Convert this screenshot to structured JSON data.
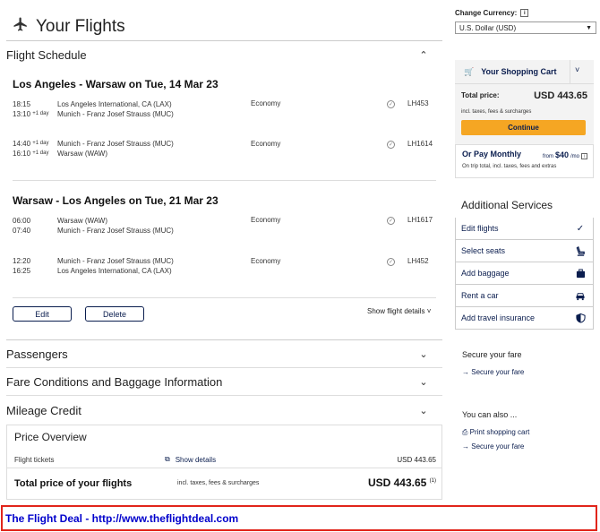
{
  "header": {
    "title": "Your Flights"
  },
  "schedule": {
    "title": "Flight Schedule",
    "trips": [
      {
        "title": "Los Angeles - Warsaw on Tue, 14 Mar 23",
        "segments": [
          {
            "dep_time": "18:15",
            "arr_time": "13:10",
            "dep_sup": "",
            "arr_sup": "+1 day",
            "from": "Los Angeles International, CA (LAX)",
            "to": "Munich - Franz Josef Strauss (MUC)",
            "cabin": "Economy",
            "flight": "LH453"
          },
          {
            "dep_time": "14:40",
            "arr_time": "16:10",
            "dep_sup": "+1 day",
            "arr_sup": "+1 day",
            "from": "Munich - Franz Josef Strauss (MUC)",
            "to": "Warsaw (WAW)",
            "cabin": "Economy",
            "flight": "LH1614"
          }
        ]
      },
      {
        "title": "Warsaw - Los Angeles on Tue, 21 Mar 23",
        "segments": [
          {
            "dep_time": "06:00",
            "arr_time": "07:40",
            "dep_sup": "",
            "arr_sup": "",
            "from": "Warsaw (WAW)",
            "to": "Munich - Franz Josef Strauss (MUC)",
            "cabin": "Economy",
            "flight": "LH1617"
          },
          {
            "dep_time": "12:20",
            "arr_time": "16:25",
            "dep_sup": "",
            "arr_sup": "",
            "from": "Munich - Franz Josef Strauss (MUC)",
            "to": "Los Angeles International, CA (LAX)",
            "cabin": "Economy",
            "flight": "LH452"
          }
        ]
      }
    ],
    "edit_label": "Edit",
    "delete_label": "Delete",
    "show_details_label": "Show flight details"
  },
  "sections": {
    "passengers": "Passengers",
    "fare_conditions": "Fare Conditions and Baggage Information",
    "mileage": "Mileage Credit"
  },
  "price_overview": {
    "title": "Price Overview",
    "tickets_label": "Flight tickets",
    "show_details": "Show details",
    "tickets_amount": "USD 443.65",
    "total_label": "Total price of your flights",
    "total_note": "incl. taxes, fees & surcharges",
    "total_amount": "USD 443.65",
    "total_footnote": "(1)"
  },
  "currency": {
    "label": "Change Currency:",
    "info": "i",
    "selected": "U.S. Dollar (USD)"
  },
  "cart": {
    "title": "Your Shopping Cart",
    "total_label": "Total price:",
    "total_amount": "USD 443.65",
    "note": "incl. taxes, fees & surcharges",
    "continue_label": "Continue",
    "monthly_label": "Or Pay Monthly",
    "monthly_from": "from",
    "monthly_amount": "$40",
    "monthly_unit": "/mo",
    "monthly_note": "On trip total, incl. taxes, fees and extras"
  },
  "additional_services": {
    "title": "Additional Services",
    "items": [
      {
        "label": "Edit flights",
        "icon": "checkmark-icon"
      },
      {
        "label": "Select seats",
        "icon": "seat-icon"
      },
      {
        "label": "Add baggage",
        "icon": "baggage-icon"
      },
      {
        "label": "Rent a car",
        "icon": "car-icon"
      },
      {
        "label": "Add travel insurance",
        "icon": "shield-icon"
      }
    ]
  },
  "secure_fare": {
    "title": "Secure your fare",
    "link": "Secure your fare"
  },
  "also": {
    "title": "You can also ...",
    "print_label": "Print shopping cart",
    "secure_link": "Secure your fare"
  },
  "footer": {
    "text": "The Flight Deal - http://www.theflightdeal.com"
  },
  "colors": {
    "brand_navy": "#0a1d4e",
    "accent_orange": "#f5a623",
    "footer_red": "#e1251b",
    "footer_link": "#0000cc"
  }
}
